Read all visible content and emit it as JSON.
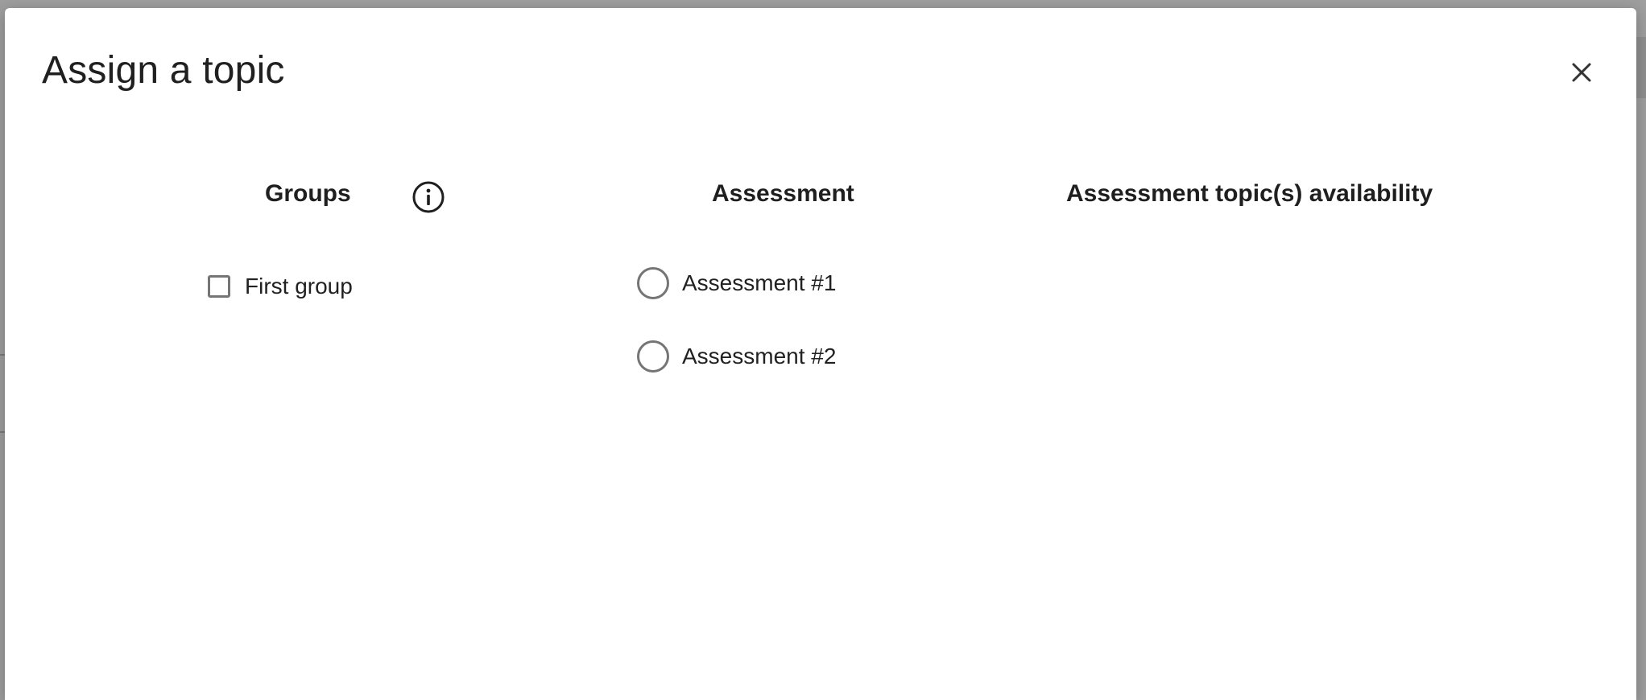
{
  "dialog": {
    "title": "Assign a topic",
    "close_icon": "close-icon"
  },
  "columns": {
    "groups": {
      "header": "Groups",
      "info_icon": "info-icon",
      "items": [
        {
          "label": "First group",
          "checked": false
        }
      ]
    },
    "assessment": {
      "header": "Assessment",
      "items": [
        {
          "label": "Assessment #1",
          "selected": false
        },
        {
          "label": "Assessment #2",
          "selected": false
        }
      ]
    },
    "availability": {
      "header": "Assessment topic(s) availability"
    }
  },
  "colors": {
    "backdrop": "#9e9e9e",
    "dialog_bg": "#ffffff",
    "text": "#212121",
    "control_border": "#757575"
  }
}
